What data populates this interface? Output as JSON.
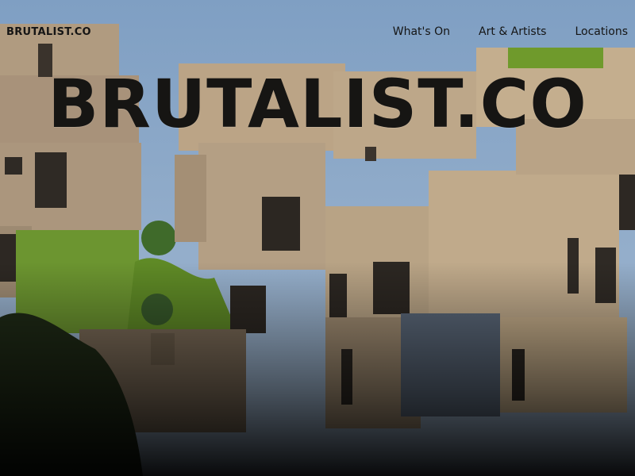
{
  "header": {
    "logo": "BRUTALIST.CO",
    "nav": [
      "What's On",
      "Art & Artists",
      "Locations"
    ]
  },
  "hero": {
    "title": "BRUTALIST.CO",
    "image": "modular concrete apartment blocks photograph"
  },
  "colors": {
    "sky": "#8fa9c6",
    "concrete": "#b8a386",
    "ivy": "#6f9a2c",
    "text": "#151515"
  }
}
